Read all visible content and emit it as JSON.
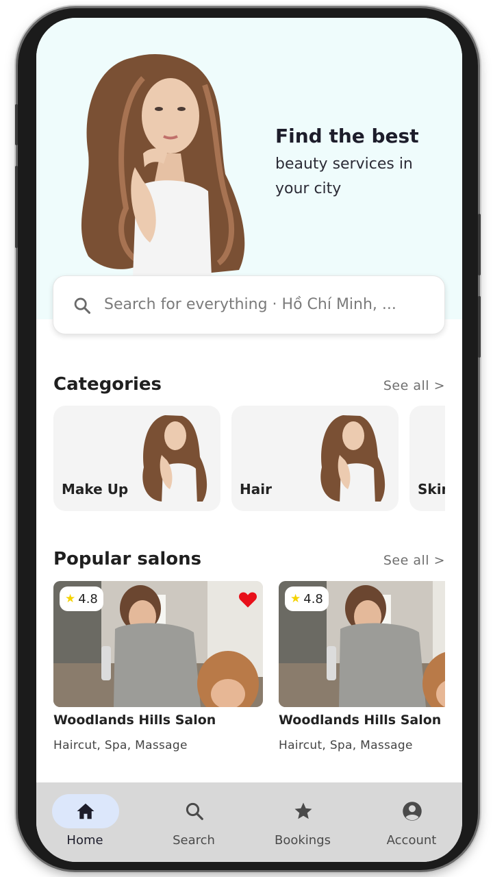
{
  "hero": {
    "title": "Find the best",
    "subtitle": "beauty services in your city"
  },
  "search": {
    "text": "Search for everything · Hồ Chí Minh, ...",
    "icon": "search-icon"
  },
  "categories": {
    "title": "Categories",
    "see_all": "See all >",
    "items": [
      {
        "label": "Make Up"
      },
      {
        "label": "Hair"
      },
      {
        "label": "Skin"
      }
    ]
  },
  "popular": {
    "title": "Popular salons",
    "see_all": "See all >",
    "items": [
      {
        "name": "Woodlands Hills Salon",
        "services": "Haircut, Spa, Massage",
        "rating": "4.8",
        "favorite": true
      },
      {
        "name": "Woodlands Hills Salon",
        "services": "Haircut, Spa, Massage",
        "rating": "4.8",
        "favorite": false
      }
    ]
  },
  "nav": {
    "items": [
      {
        "label": "Home",
        "icon": "home-icon",
        "active": true
      },
      {
        "label": "Search",
        "icon": "search-icon",
        "active": false
      },
      {
        "label": "Bookings",
        "icon": "star-icon",
        "active": false
      },
      {
        "label": "Account",
        "icon": "account-icon",
        "active": false
      }
    ]
  },
  "colors": {
    "hero_bg": "#effcfc",
    "rating_star": "#f5d300",
    "favorite_heart": "#e8101a",
    "nav_bg": "#d8d8d8",
    "nav_active_pill": "#dce7fb"
  }
}
